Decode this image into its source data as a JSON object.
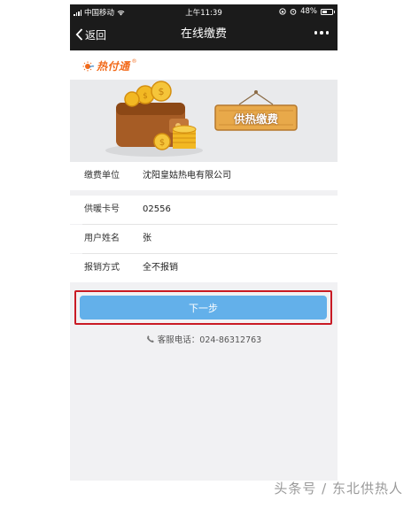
{
  "status_bar": {
    "carrier": "中国移动",
    "time": "上午11:39",
    "battery": "48%"
  },
  "nav": {
    "back_label": "返回",
    "title": "在线缴费"
  },
  "logo": {
    "text": "热付通",
    "reg": "®"
  },
  "banner": {
    "sign_text": "供热缴费"
  },
  "form": {
    "payee_label": "缴费单位",
    "payee_value": "沈阳皇姑热电有限公司",
    "card_label": "供暖卡号",
    "card_value": "02556",
    "name_label": "用户姓名",
    "name_value": "张",
    "reimburse_label": "报销方式",
    "reimburse_value": "全不报销"
  },
  "next_button": "下一步",
  "hotline": "客服电话：024-86312763",
  "watermark": "头条号 / 东北供热人",
  "colors": {
    "nav_bg": "#1b1b1b",
    "button_blue": "#63b0ea",
    "highlight_red": "#c91a24",
    "logo_orange": "#f26a1a"
  }
}
